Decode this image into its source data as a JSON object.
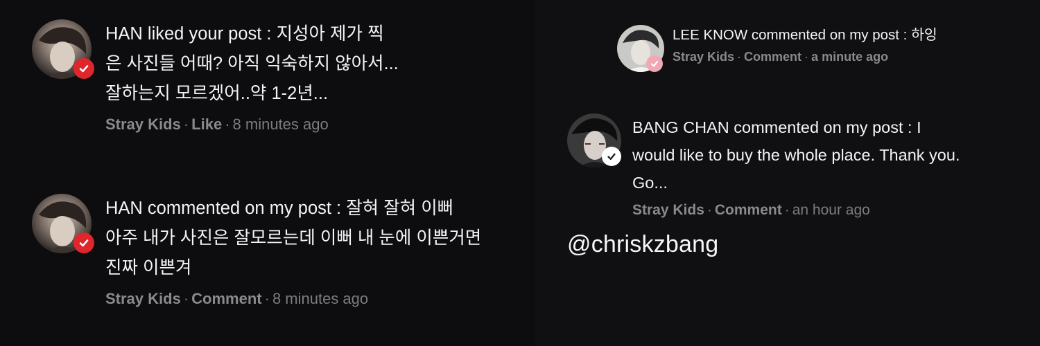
{
  "colors": {
    "background": "#0c0c0e",
    "text_primary": "#f4f4f4",
    "text_meta": "#7c7c80",
    "badge_red": "#e0262b",
    "badge_pink": "#f1a8b6"
  },
  "notifications": [
    {
      "message": "HAN liked your post : 지성아 제가 찍\n은 사진들 어때? 아직 익숙하지 않아서...\n잘하는지 모르겠어..약 1-2년...",
      "group": "Stray Kids",
      "action": "Like",
      "time": "8 minutes ago",
      "badge_icon": "verified-badge-icon"
    },
    {
      "message": "HAN commented on my post : 잘혀 잘혀 이뻐\n아주 내가 사진은 잘모르는데 이뻐 내 눈에 이쁜거면\n진짜 이쁜겨",
      "group": "Stray Kids",
      "action": "Comment",
      "time": "8 minutes ago",
      "badge_icon": "verified-badge-icon"
    },
    {
      "message": "LEE KNOW commented on my post : 하잉",
      "group": "Stray Kids",
      "action": "Comment",
      "time": "a minute ago",
      "badge_icon": "verified-badge-icon"
    },
    {
      "message": "BANG CHAN commented on my post : I\nwould like to buy the whole place. Thank you.\nGo...",
      "group": "Stray Kids",
      "action": "Comment",
      "time": "an hour ago",
      "badge_icon": "verified-badge-icon"
    }
  ],
  "watermark": "@chriskzbang"
}
